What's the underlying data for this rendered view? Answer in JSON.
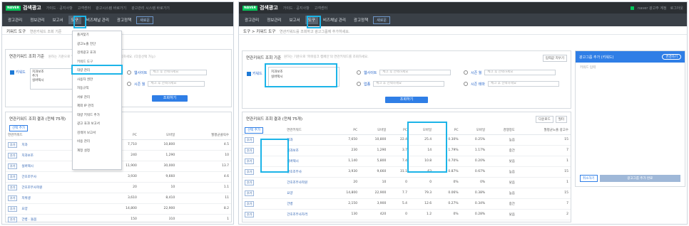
{
  "brand": {
    "logo": "NAVER",
    "name": "검색광고"
  },
  "left": {
    "top_links": [
      "가이드 · 공지사항",
      "고객센터",
      "광고시스템 바로가기",
      "광고관리 시스템 바로가기"
    ],
    "menu": [
      "광고관리",
      "정보관리",
      "보고서",
      "도구",
      "비즈채널 관리",
      "광고정책"
    ],
    "menu_btn": "새로운",
    "crumb": "키워드 도구",
    "crumb_sub": "연관키워드 조회 기준",
    "search": {
      "title": "연관키워드 조회 기준",
      "hint": "원하는 기준으로 '파워링크 캠페인'의 연관키워드를 조회하세요. (다중선택 가능)",
      "keyword_label": "키워드",
      "keyword_lines": [
        "치과보조",
        "추가",
        "실버택시"
      ],
      "web_label": "웹사이트",
      "web_placeholder": "체크 후 선택하세요",
      "season_label": "시즌 월",
      "season_placeholder": "체크 후 선택하세요",
      "submit": "조회하기"
    },
    "result": {
      "title": "연관키워드 조회 결과 (전체 75개)",
      "add_btn": "선택 추가",
      "col_keyword": "연관키워드",
      "col_group1": "월간검색수",
      "col_group2": "월평균클릭수",
      "col_pc": "PC",
      "col_mobile": "모바일",
      "rows": [
        {
          "tag": "추가",
          "kw": "치과",
          "pc": "7,710",
          "m": "10,800",
          "c": "4.5"
        },
        {
          "tag": "추가",
          "kw": "치과보조",
          "pc": "240",
          "m": "1,290",
          "c": "10"
        },
        {
          "tag": "추가",
          "kw": "실버택시",
          "pc": "11,900",
          "m": "30,000",
          "c": "13.7"
        },
        {
          "tag": "추가",
          "kw": "간호조무사",
          "pc": "3,930",
          "m": "9,660",
          "c": "4.6"
        },
        {
          "tag": "추가",
          "kw": "간호조무사학원",
          "pc": "20",
          "m": "10",
          "c": "1.1"
        },
        {
          "tag": "추가",
          "kw": "치위생",
          "pc": "3,610",
          "m": "8,410",
          "c": "11"
        },
        {
          "tag": "추가",
          "kw": "요양",
          "pc": "14,800",
          "m": "22,900",
          "c": "8.2"
        },
        {
          "tag": "추가",
          "kw": "간병 · 돌봄",
          "pc": "150",
          "m": "310",
          "c": "1"
        }
      ]
    },
    "dropdown": [
      "즐겨찾기",
      "광고노출 진단",
      "검색광고 효과",
      "키워드 도구",
      "대량 관리",
      "사용자 권한",
      "자동규칙",
      "서류 관리",
      "제외 IP 관리",
      "대량 키워드 추가",
      "광고 효과 보고서",
      "검색어 보고서",
      "비용 관리",
      "계정 설정"
    ]
  },
  "right": {
    "account": "naver 광고주 계정",
    "top_links": [
      "가이드 · 공지사항",
      "고객센터",
      "로그아웃"
    ],
    "menu": [
      "광고관리",
      "정보관리",
      "보고서",
      "도구",
      "비즈채널 관리",
      "광고정책"
    ],
    "menu_btn": "새로운",
    "crumb": "도구 > 키워드 도구",
    "crumb_sub": "연관키워드를 조회하고 광고그룹에 추가하세요.",
    "search": {
      "title": "연관키워드 조회 기준",
      "hint": "원하는 기준으로 '파워링크 캠페인'의 연관키워드를 조회하세요.",
      "reset": "입력값 지우기",
      "keyword_label": "키워드",
      "keyword_lines": [
        "치과보조",
        "실버택시"
      ],
      "web_label": "웹사이트",
      "web_placeholder": "체크 후 선택하세요",
      "industry_label": "업종",
      "industry_placeholder": "체크 후 선택하세요",
      "season_label": "시즌 월",
      "season_placeholder": "체크 후 선택하세요",
      "theme_label": "시즌 테마",
      "theme_placeholder": "체크 후 선택하세요",
      "submit": "조회하기"
    },
    "result": {
      "title": "연관키워드 조회 결과 (전체 75개)",
      "download": "다운로드",
      "filter": "필터",
      "add_btn": "선택 추가",
      "col_keyword": "연관키워드",
      "col_g1": "월간검색수",
      "col_g2": "월평균클릭수",
      "col_g3": "월평균클릭률",
      "col_comp": "경쟁정도",
      "col_ads": "월평균노출 광고수",
      "col_pc": "PC",
      "col_mobile": "모바일",
      "rows": [
        {
          "tag": "추가",
          "kw": "치과",
          "pc": "7,650",
          "m": "10,800",
          "c1": "22.4",
          "c2": "25.4",
          "r1": "0.30%",
          "r2": "0.25%",
          "comp": "높음",
          "ads": "15"
        },
        {
          "tag": "추가",
          "kw": "치과보조",
          "pc": "230",
          "m": "1,290",
          "c1": "3.7",
          "c2": "14",
          "r1": "1.79%",
          "r2": "1.17%",
          "comp": "중간",
          "ads": "7"
        },
        {
          "tag": "추가",
          "kw": "실버택시",
          "pc": "1,140",
          "m": "5,800",
          "c1": "7.4",
          "c2": "10.8",
          "r1": "0.70%",
          "r2": "0.20%",
          "comp": "낮음",
          "ads": "1"
        },
        {
          "tag": "추가",
          "kw": "간호조무사",
          "pc": "3,930",
          "m": "9,660",
          "c1": "31.1",
          "c2": "63",
          "r1": "0.87%",
          "r2": "0.67%",
          "comp": "높음",
          "ads": "15"
        },
        {
          "tag": "추가",
          "kw": "간호조무사학원",
          "pc": "20",
          "m": "10",
          "c1": "0",
          "c2": "0",
          "r1": "0%",
          "r2": "0%",
          "comp": "낮음",
          "ads": "1"
        },
        {
          "tag": "추가",
          "kw": "요양",
          "pc": "14,800",
          "m": "22,900",
          "c1": "7.7",
          "c2": "79.3",
          "r1": "0.06%",
          "r2": "0.38%",
          "comp": "높음",
          "ads": "15"
        },
        {
          "tag": "추가",
          "kw": "간병",
          "pc": "2,150",
          "m": "3,900",
          "c1": "5.4",
          "c2": "12.6",
          "r1": "0.27%",
          "r2": "0.34%",
          "comp": "중간",
          "ads": "7"
        },
        {
          "tag": "추가",
          "kw": "간호조무사자격",
          "pc": "130",
          "m": "420",
          "c1": "0",
          "c2": "1.2",
          "r1": "0%",
          "r2": "0.28%",
          "comp": "낮음",
          "ads": "2"
        }
      ]
    },
    "side": {
      "title": "광고그룹 추가 (키워드)",
      "pill": "변경하기",
      "placeholder": "키워드 입력",
      "cancel": "취소하기",
      "confirm": "광고그룹 추가 완료"
    }
  }
}
